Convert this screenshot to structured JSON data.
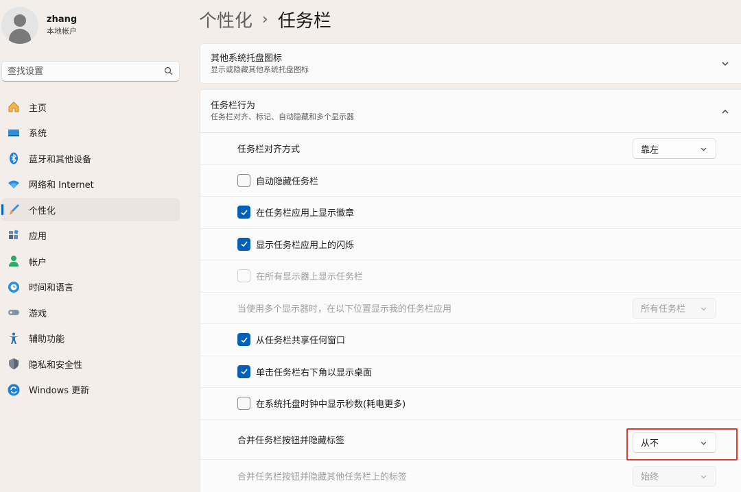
{
  "profile": {
    "name": "zhang",
    "account_type": "本地帐户"
  },
  "search": {
    "placeholder": "查找设置"
  },
  "nav": {
    "items": [
      {
        "label": "主页",
        "icon": "home-icon"
      },
      {
        "label": "系统",
        "icon": "system-icon"
      },
      {
        "label": "蓝牙和其他设备",
        "icon": "bluetooth-icon"
      },
      {
        "label": "网络和 Internet",
        "icon": "wifi-icon"
      },
      {
        "label": "个性化",
        "icon": "brush-icon",
        "active": true
      },
      {
        "label": "应用",
        "icon": "apps-icon"
      },
      {
        "label": "帐户",
        "icon": "account-icon"
      },
      {
        "label": "时间和语言",
        "icon": "globe-clock-icon"
      },
      {
        "label": "游戏",
        "icon": "gamepad-icon"
      },
      {
        "label": "辅助功能",
        "icon": "accessibility-icon"
      },
      {
        "label": "隐私和安全性",
        "icon": "shield-icon"
      },
      {
        "label": "Windows 更新",
        "icon": "update-icon"
      }
    ]
  },
  "breadcrumb": {
    "parent": "个性化",
    "separator": "›",
    "current": "任务栏"
  },
  "tray_card": {
    "title": "其他系统托盘图标",
    "desc": "显示或隐藏其他系统托盘图标",
    "expanded": false
  },
  "behavior_card": {
    "title": "任务栏行为",
    "desc": "任务栏对齐、标记、自动隐藏和多个显示器",
    "expanded": true
  },
  "rows": {
    "align": {
      "label": "任务栏对齐方式",
      "value": "靠左"
    },
    "autohide": {
      "label": "自动隐藏任务栏",
      "checked": false
    },
    "badges": {
      "label": "在任务栏应用上显示徽章",
      "checked": true
    },
    "flash": {
      "label": "显示任务栏应用上的闪烁",
      "checked": true
    },
    "all_displays": {
      "label": "在所有显示器上显示任务栏",
      "checked": false,
      "disabled": true
    },
    "multi_display": {
      "label": "当使用多个显示器时，在以下位置显示我的任务栏应用",
      "value": "所有任务栏",
      "disabled": true
    },
    "share_window": {
      "label": "从任务栏共享任何窗口",
      "checked": true
    },
    "show_desktop": {
      "label": "单击任务栏右下角以显示桌面",
      "checked": true
    },
    "seconds": {
      "label": "在系统托盘时钟中显示秒数(耗电更多)",
      "checked": false
    },
    "combine": {
      "label": "合并任务栏按钮并隐藏标签",
      "value": "从不"
    },
    "combine_other": {
      "label": "合并任务栏按钮并隐藏其他任务栏上的标签",
      "value": "始终",
      "disabled": true
    }
  },
  "colors": {
    "accent": "#005fb8",
    "highlight": "#e03a2c"
  }
}
